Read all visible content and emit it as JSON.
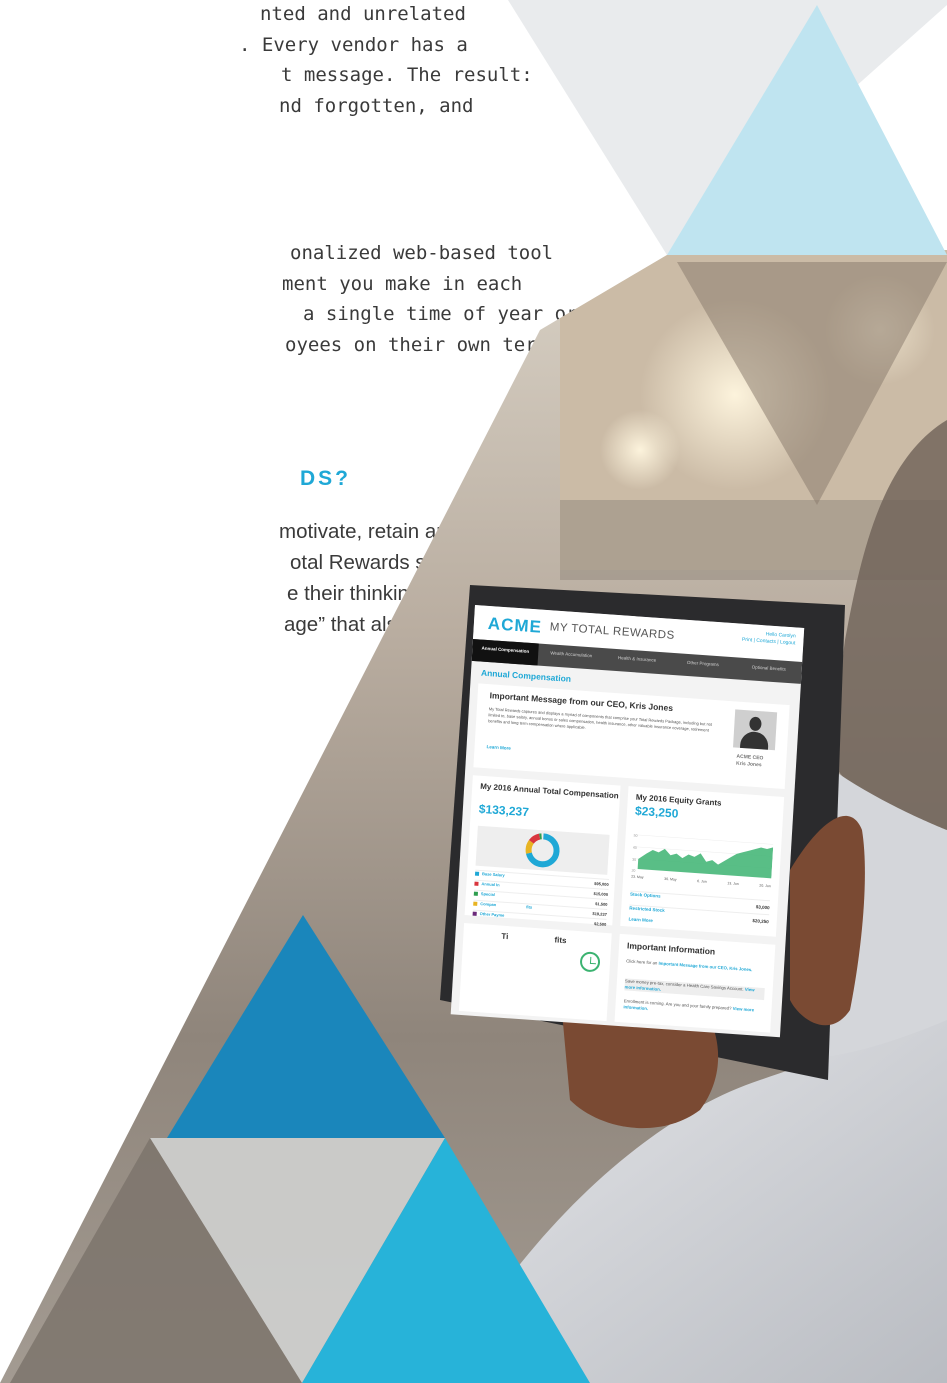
{
  "intro": {
    "lines": [
      "nted and unrelated",
      ". Every vendor has a",
      "t message. The result:",
      "nd forgotten, and"
    ]
  },
  "tool": {
    "lines": [
      "onalized web-based tool",
      "ment you make in each",
      "a single time of year or a",
      "oyees on their own terms"
    ]
  },
  "heading": "DS?",
  "why": {
    "lines": [
      "motivate, retain and attract",
      "otal Rewards solution helps",
      "e their thinking from “base",
      "age” that also includes:"
    ]
  },
  "colors": {
    "accent": "#1fa8d6",
    "light_triangle": "#bfe4f0",
    "dark_triangle": "#1a86bb",
    "bright_triangle": "#27b3d9"
  },
  "tablet": {
    "logo": "ACME",
    "app_title": "MY TOTAL REWARDS",
    "hello": "Hello Carolyn",
    "header_links": "Print | Contacts | Logout",
    "tabs": [
      "Annual Compensation",
      "Wealth Accumulation",
      "Health & Insurance",
      "Other Programs",
      "Optional Benefits"
    ],
    "section_title": "Annual Compensation",
    "message": {
      "title": "Important Message from our CEO, Kris Jones",
      "body": "My Total Rewards captures and displays a myriad of components that comprise your Total Rewards Package, including but not limited to, base salary, annual bonus or sales compensation, health insurance, other valuable insurance coverage, retirement benefits and long term compensation where applicable.",
      "learn_more": "Learn More",
      "ceo_title": "ACME CEO",
      "ceo_name": "Kris Jones"
    },
    "comp_card": {
      "title": "My 2016 Annual Total Compensation",
      "value": "$133,237",
      "legend": [
        {
          "label": "Base Salary",
          "value": "$95,000",
          "color": "#1fa8d6"
        },
        {
          "label": "Annual In",
          "value": "$15,000",
          "color": "#d9363e"
        },
        {
          "label": "Special",
          "value": "$1,500",
          "color": "#2e9e4f"
        },
        {
          "label": "Compan",
          "value": "$19,237",
          "color": "#e8b422"
        },
        {
          "label": "Other Payme",
          "value": "$2,500",
          "color": "#6b2a7a"
        }
      ],
      "legend_suffix": "fits"
    },
    "equity_card": {
      "title": "My 2016 Equity Grants",
      "value": "$23,250",
      "axis": [
        "23. May",
        "30. May",
        "6. Jun",
        "13. Jun",
        "20. Jun"
      ],
      "y_ticks": [
        "50",
        "40",
        "30",
        "20"
      ],
      "rows": [
        {
          "label": "Stock Options",
          "value": "$3,000"
        },
        {
          "label": "Restricted Stock",
          "value": "$20,250"
        }
      ],
      "learn_more": "Learn More"
    },
    "time_card": {
      "title_left": "Ti",
      "title_right": "fits"
    },
    "info_card": {
      "title": "Important Information",
      "line1_prefix": "Click here for an ",
      "line1_link": "Important Message from our CEO, Kris Jones.",
      "line2_prefix": "Save money pre-tax, consider a Health Care Savings Account. ",
      "line2_link": "View more information.",
      "line3_prefix": "Enrollment is coming. Are you and your family prepared? ",
      "line3_link": "View more information."
    }
  }
}
